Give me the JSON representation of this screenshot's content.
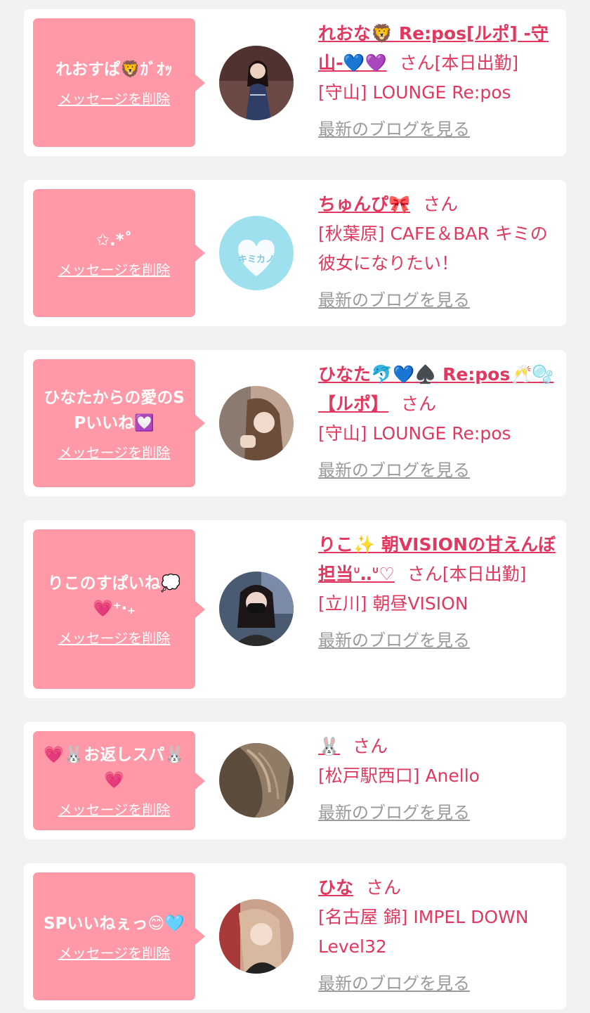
{
  "items": [
    {
      "message": "れおすぱ🦁ｶﾞｵｯ",
      "delete_label": "メッセージを削除",
      "name": "れおな🦁 Re:pos[ルポ] -守山-💙💜",
      "san": "さん",
      "status": "[本日出勤]",
      "shop": "[守山] LOUNGE Re:pos",
      "blog_label": "最新のブログを見る",
      "avatar_color": "#6b4a45"
    },
    {
      "message": "✩.*˚",
      "delete_label": "メッセージを削除",
      "name": "ちゅんぴ🎀",
      "san": "さん",
      "status": "",
      "shop": "[秋葉原] CAFE＆BAR キミの彼女になりたい！",
      "blog_label": "最新のブログを見る",
      "avatar_color": "#9fe0ee",
      "avatar_text": "キミカノ"
    },
    {
      "message": "ひなたからの愛のSPいいね💟",
      "delete_label": "メッセージを削除",
      "name": "ひなた🐬💙♠️ Re:pos🥂🫧【ルポ】",
      "san": "さん",
      "status": "",
      "shop": "[守山] LOUNGE Re:pos",
      "blog_label": "最新のブログを見る",
      "avatar_color": "#bfa393"
    },
    {
      "message": "りこのすぱいね💭💗⁺‧₊",
      "delete_label": "メッセージを削除",
      "name": "りこ✨ 朝VISIONの甘えんぼ担当ᐡ‥ᐡ♡",
      "san": "さん",
      "status": "[本日出勤]",
      "shop": "[立川] 朝昼VISION",
      "blog_label": "最新のブログを見る",
      "avatar_color": "#4a5a70"
    },
    {
      "message": "💗🐰お返しスパ🐰💗",
      "delete_label": "メッセージを削除",
      "name": "🐰",
      "san": "さん",
      "status": "",
      "shop": "[松戸駅西口] Anello",
      "blog_label": "最新のブログを見る",
      "avatar_color": "#5c4c3e"
    },
    {
      "message": "SPいいねぇっ😊🩵",
      "delete_label": "メッセージを削除",
      "name": "ひな",
      "san": "さん",
      "status": "",
      "shop": "[名古屋 錦] IMPEL DOWN Level32",
      "blog_label": "最新のブログを見る",
      "avatar_color": "#c9a18c"
    }
  ]
}
